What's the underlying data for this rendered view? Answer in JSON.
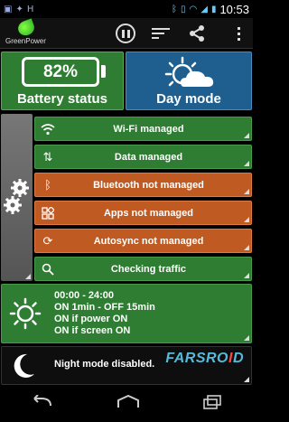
{
  "statusbar": {
    "left_icons": [
      "android-icon",
      "debug-icon",
      "h-icon"
    ],
    "time": "10:53"
  },
  "app": {
    "name": "GreenPower"
  },
  "battery": {
    "percent": "82%",
    "label": "Battery status"
  },
  "day": {
    "label": "Day mode"
  },
  "rows": [
    {
      "label": "Wi-Fi managed",
      "state": "managed",
      "icon": "wifi-icon"
    },
    {
      "label": "Data managed",
      "state": "managed",
      "icon": "data-arrows-icon"
    },
    {
      "label": "Bluetooth not managed",
      "state": "not-managed",
      "icon": "bluetooth-icon"
    },
    {
      "label": "Apps not managed",
      "state": "not-managed",
      "icon": "apps-grid-icon"
    },
    {
      "label": "Autosync not managed",
      "state": "not-managed",
      "icon": "sync-icon"
    },
    {
      "label": "Checking traffic",
      "state": "managed",
      "icon": "search-icon"
    }
  ],
  "schedule": {
    "line1": "00:00 - 24:00",
    "line2": "ON 1min - OFF 15min",
    "line3": "ON if power ON",
    "line4": "ON if screen ON"
  },
  "night": {
    "label": "Night mode disabled."
  },
  "watermark": {
    "part1": "FARSRO",
    "part2": "I",
    "part3": "D"
  },
  "colors": {
    "managed": "#2e7d32",
    "not_managed": "#c05a23",
    "day_blue": "#1f5f8f"
  }
}
